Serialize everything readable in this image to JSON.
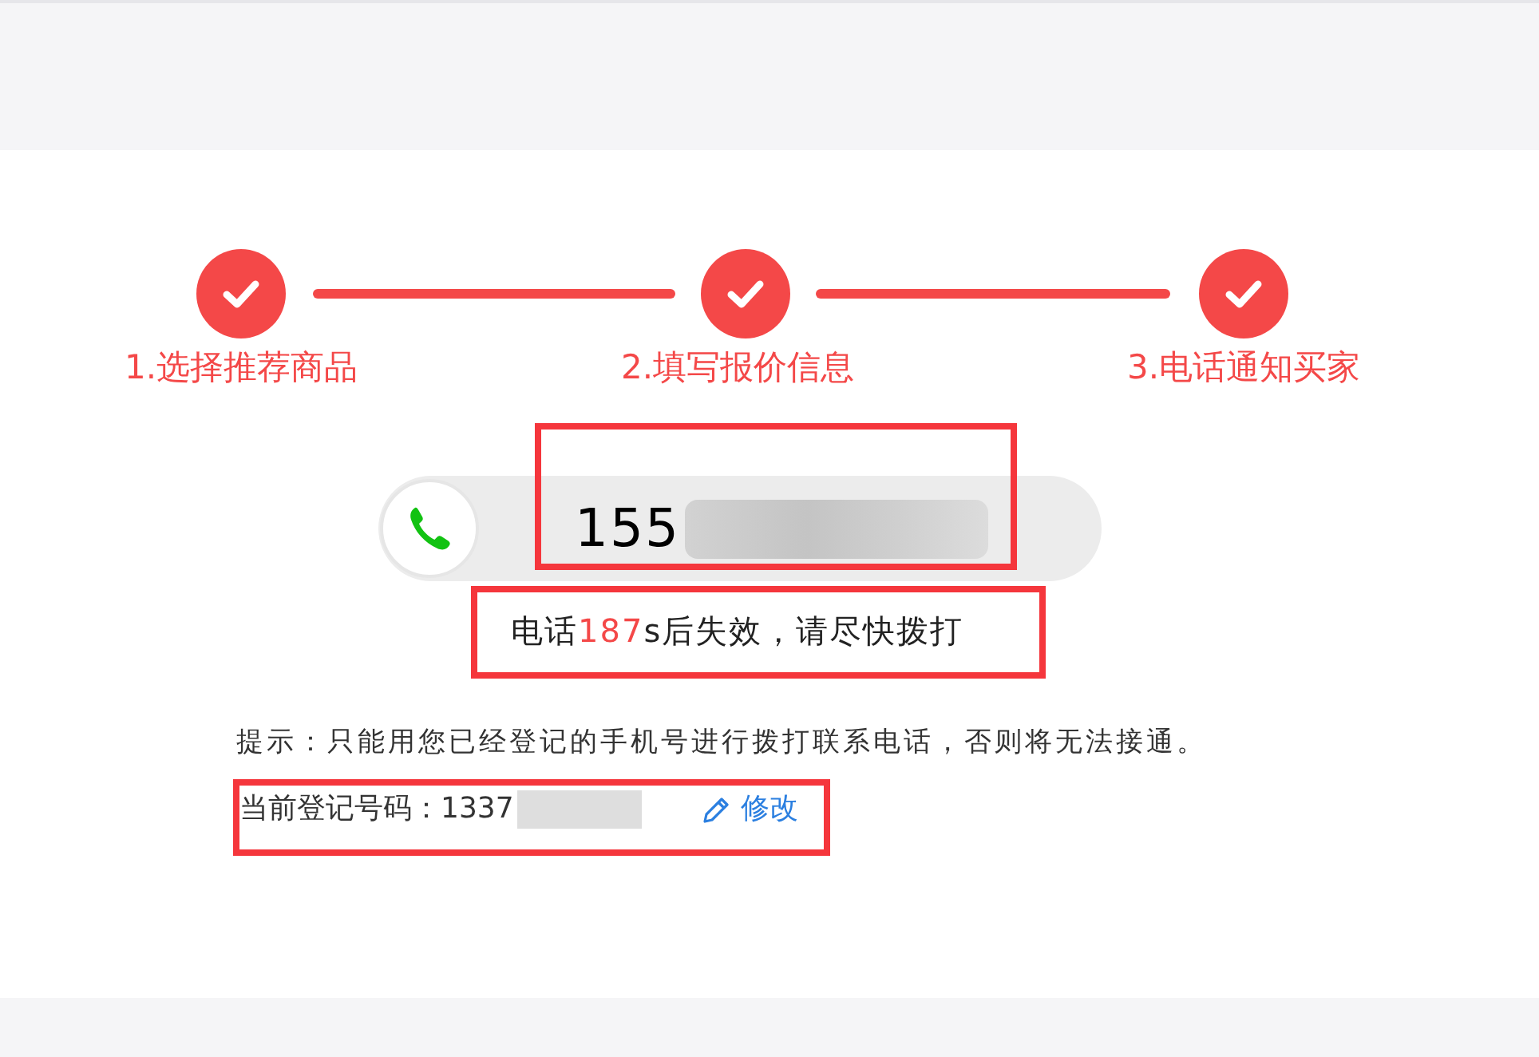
{
  "steps": [
    {
      "label": "1.选择推荐商品",
      "completed": true
    },
    {
      "label": "2.填写报价信息",
      "completed": true
    },
    {
      "label": "3.电话通知买家",
      "completed": true
    }
  ],
  "phone_number": {
    "visible_digits": "155",
    "highlighted": true
  },
  "countdown": {
    "prefix": "电话",
    "seconds": "187",
    "suffix": "s后失效，请尽快拨打",
    "highlighted": true
  },
  "hint": "提示：只能用您已经登记的手机号进行拨打联系电话，否则将无法接通。",
  "registered": {
    "text": "当前登记号码：1337",
    "edit_link": "修改",
    "highlighted": true
  }
}
